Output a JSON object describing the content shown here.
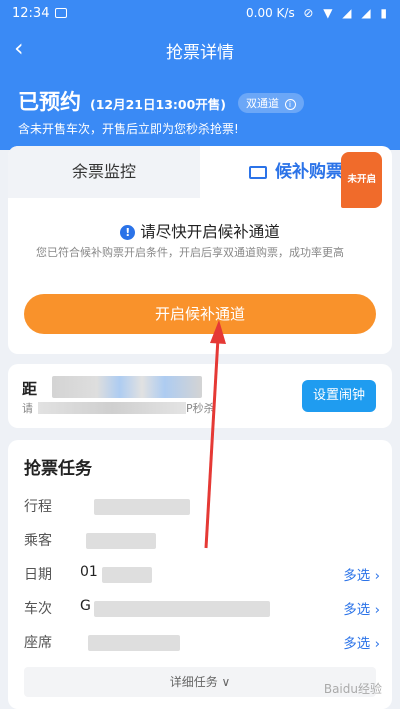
{
  "status_bar": {
    "time": "12:34",
    "speed": "0.00 K/s",
    "icons": "⊘ ▼ ◢ ◢ ▮"
  },
  "header": {
    "title": "抢票详情",
    "back": "‹",
    "booked": "已预约",
    "sale_time": "(12月21日13:00开售)",
    "dual_channel": "双通道",
    "dual_info": "i",
    "subtitle": "含未开售车次，开售后立即为您秒杀抢票!"
  },
  "tabs": {
    "left": "余票监控",
    "right": "候补购票",
    "right_badge": "未开启"
  },
  "waitlist": {
    "warn_mark": "!",
    "warning": "请尽快开启候补通道",
    "description": "您已符合候补购票开启条件，开启后享双通道购票，成功率更高",
    "button": "开启候补通道"
  },
  "alarm": {
    "title_char": "距",
    "sub_first": "请",
    "sub_suffix": "P秒杀",
    "button": "设置闹钟"
  },
  "task": {
    "title": "抢票任务",
    "rows": [
      {
        "label": "行程",
        "value": "",
        "more": ""
      },
      {
        "label": "乘客",
        "value": "",
        "more": ""
      },
      {
        "label": "日期",
        "value": "01",
        "more": "多选 ›"
      },
      {
        "label": "车次",
        "value": "G",
        "more": "多选 ›"
      },
      {
        "label": "座席",
        "value": "",
        "more": "多选 ›"
      }
    ],
    "detail": "详细任务 ∨"
  },
  "watermark": "Baidu经验"
}
